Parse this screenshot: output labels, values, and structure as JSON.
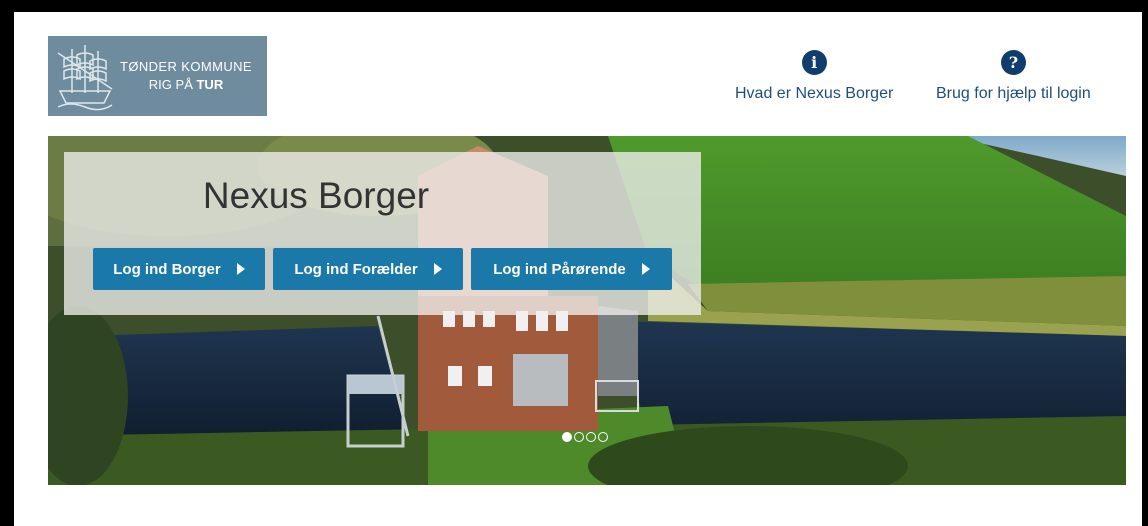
{
  "logo": {
    "line1": "TØNDER KOMMUNE",
    "line2_prefix": "RIG PÅ ",
    "line2_bold": "TUR",
    "background": "#6e8c9e"
  },
  "header_links": [
    {
      "icon": "info-icon",
      "glyph": "i",
      "label": "Hvad er Nexus Borger"
    },
    {
      "icon": "question-icon",
      "glyph": "?",
      "label": "Brug for hjælp til login"
    }
  ],
  "hero": {
    "title": "Nexus Borger",
    "buttons": [
      {
        "label": "Log ind Borger"
      },
      {
        "label": "Log ind Forælder"
      },
      {
        "label": "Log ind Pårørende"
      }
    ],
    "carousel_dots": 4,
    "active_dot": 1
  },
  "colors": {
    "accent_button": "#1a79a8",
    "link_text": "#1e4f7a",
    "icon_circle": "#0f3d6e"
  }
}
